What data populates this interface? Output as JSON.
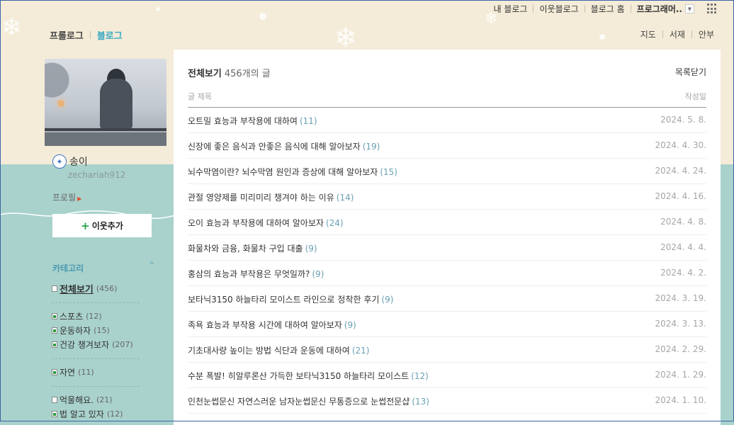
{
  "top_nav": {
    "links": [
      "내 블로그",
      "이웃블로그",
      "블로그 홈"
    ],
    "selected": "프로그래머..",
    "dropdown_icon": "chevron-down-icon",
    "apps_icon": "apps-grid-icon"
  },
  "blog_nav": {
    "prologue": "프롤로그",
    "blog": "블로그",
    "utils": [
      "지도",
      "서재",
      "안부"
    ]
  },
  "profile": {
    "nickname": "송이",
    "user_id": "zechariah912",
    "profile_link": "프로필",
    "add_neighbor": "이웃추가",
    "add_icon": "+"
  },
  "categories": {
    "title": "카테고리",
    "toggle_icon": "^",
    "groups": [
      [
        {
          "label": "전체보기",
          "count": "(456)",
          "type": "all"
        }
      ],
      [
        {
          "label": "스포츠",
          "count": "(12)",
          "type": "green"
        },
        {
          "label": "운동하자",
          "count": "(15)",
          "type": "green"
        },
        {
          "label": "건강 챙겨보자",
          "count": "(207)",
          "type": "green"
        }
      ],
      [
        {
          "label": "자연",
          "count": "(11)",
          "type": "green"
        }
      ],
      [
        {
          "label": "억울해요.",
          "count": "(21)",
          "type": "plain"
        },
        {
          "label": "법 알고 있자",
          "count": "(12)",
          "type": "green"
        }
      ]
    ]
  },
  "post_list": {
    "heading": "전체보기",
    "count": "456개의 글",
    "close_label": "목록닫기",
    "col_title": "글 제목",
    "col_date": "작성일",
    "posts": [
      {
        "title": "오트밀 효능과 부작용에 대하여",
        "comments": "(11)",
        "date": "2024. 5. 8."
      },
      {
        "title": "신장에 좋은 음식과 안좋은 음식에 대해 알아보자",
        "comments": "(19)",
        "date": "2024. 4. 30."
      },
      {
        "title": "뇌수막염이란? 뇌수막염 원인과 증상에 대해 알아보자",
        "comments": "(15)",
        "date": "2024. 4. 24."
      },
      {
        "title": "관절 영양제를 미리미리 챙겨야 하는 이유",
        "comments": "(14)",
        "date": "2024. 4. 16."
      },
      {
        "title": "오이 효능과 부작용에 대하여 알아보자",
        "comments": "(24)",
        "date": "2024. 4. 8."
      },
      {
        "title": "화물차와 금융, 화물차 구입 대출",
        "comments": "(9)",
        "date": "2024. 4. 4."
      },
      {
        "title": "홍삼의 효능과 부작용은 무엇일까?",
        "comments": "(9)",
        "date": "2024. 4. 2."
      },
      {
        "title": "보타닉3150 하늘타리 모이스트 라인으로 정착한 후기",
        "comments": "(9)",
        "date": "2024. 3. 19."
      },
      {
        "title": "족욕 효능과 부작용 시간에 대하여 알아보자",
        "comments": "(9)",
        "date": "2024. 3. 13."
      },
      {
        "title": "기초대사량 높이는 방법 식단과 운동에 대하여",
        "comments": "(21)",
        "date": "2024. 2. 29."
      },
      {
        "title": "수분 폭발! 히알루론산 가득한 보타닉3150 하늘타리 모이스트",
        "comments": "(12)",
        "date": "2024. 1. 29."
      },
      {
        "title": "인천눈썹문신 자연스러운 남자눈썹문신 무통증으로 눈썹전문샵",
        "comments": "(13)",
        "date": "2024. 1. 10."
      }
    ]
  }
}
